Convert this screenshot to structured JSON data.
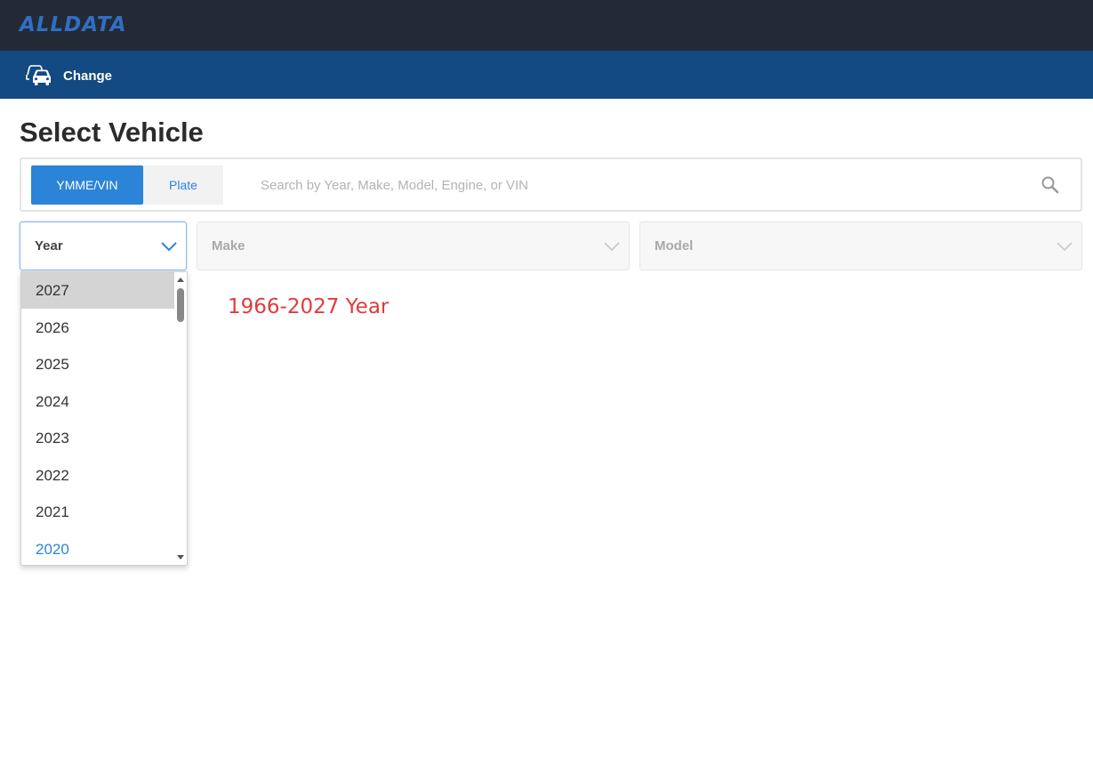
{
  "header": {
    "logo_text": "ALLDATA",
    "change_label": "Change",
    "change_icon": "car-change-icon"
  },
  "page_title": "Select Vehicle",
  "search": {
    "tabs": [
      {
        "label": "YMME/VIN",
        "active": true
      },
      {
        "label": "Plate",
        "active": false
      }
    ],
    "placeholder": "Search by Year, Make, Model, Engine, or VIN",
    "icon": "search-icon"
  },
  "selects": {
    "year": {
      "label": "Year"
    },
    "make": {
      "label": "Make"
    },
    "model": {
      "label": "Model"
    }
  },
  "year_dropdown": {
    "items": [
      "2027",
      "2026",
      "2025",
      "2024",
      "2023",
      "2022",
      "2021",
      "2020"
    ],
    "highlighted": "2027",
    "blue_item": "2020"
  },
  "range_note": "1966-2027 Year",
  "colors": {
    "topbar": "#232a35",
    "subbar": "#134a82",
    "accent": "#2b84d8",
    "note": "#e23b3b"
  }
}
